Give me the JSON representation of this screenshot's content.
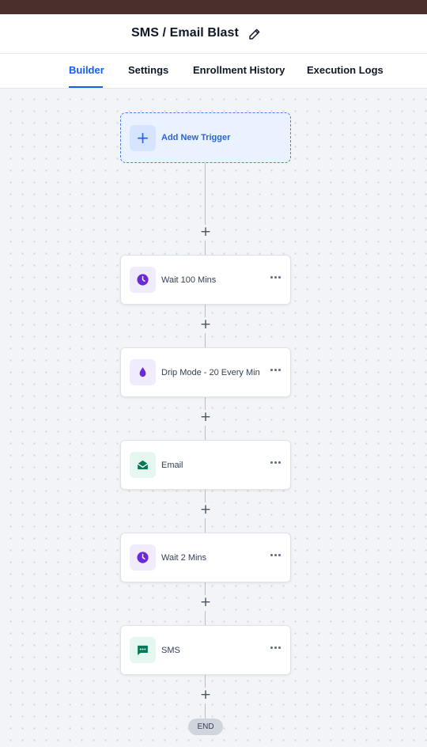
{
  "header": {
    "title": "SMS / Email Blast",
    "edit_icon": "pencil-icon"
  },
  "tabs": [
    {
      "label": "Builder",
      "active": true
    },
    {
      "label": "Settings",
      "active": false
    },
    {
      "label": "Enrollment History",
      "active": false
    },
    {
      "label": "Execution Logs",
      "active": false
    }
  ],
  "colors": {
    "accent": "#155eef",
    "topbar": "#4a2f2d",
    "purple_icon": "#6d28d9",
    "green_icon": "#047857"
  },
  "workflow": {
    "trigger": {
      "label": "Add New Trigger",
      "icon": "plus-icon"
    },
    "add_step_symbol": "+",
    "steps": [
      {
        "label": "Wait 100 Mins",
        "icon": "clock-icon"
      },
      {
        "label": "Drip Mode - 20 Every Min",
        "icon": "drop-icon"
      },
      {
        "label": "Email",
        "icon": "mail-open-icon"
      },
      {
        "label": "Wait 2 Mins",
        "icon": "clock-icon"
      },
      {
        "label": "SMS",
        "icon": "sms-icon"
      }
    ],
    "end_label": "END"
  }
}
